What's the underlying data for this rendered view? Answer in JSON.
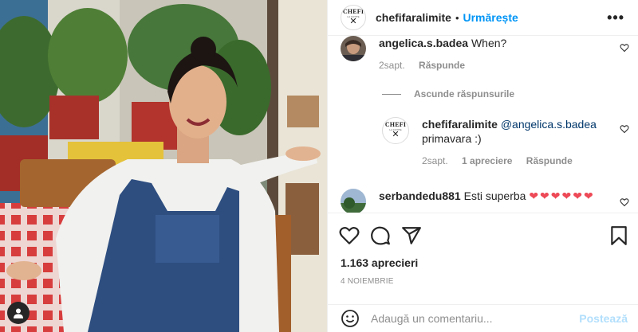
{
  "header": {
    "account": "chefifaralimite",
    "separator": "•",
    "follow_label": "Urmărește",
    "more_label": "•••",
    "logo_text": "CHEFI",
    "logo_sub": "LA CUȚITE",
    "logo_symbol": "✕"
  },
  "comments": [
    {
      "user": "angelica.s.badea",
      "text": "When?",
      "age": "2sapt.",
      "reply_label": "Răspunde"
    }
  ],
  "hide_replies_label": "Ascunde răspunsurile",
  "reply": {
    "user": "chefifaralimite",
    "mention": "@angelica.s.badea",
    "text": "primavara :)",
    "age": "2sapt.",
    "likes": "1 apreciere",
    "reply_label": "Răspunde"
  },
  "comment3": {
    "user": "serbandedu881",
    "text": "Esti superba",
    "hearts": "❤❤❤❤❤❤"
  },
  "likes_count": "1.163 aprecieri",
  "date": "4 NOIEMBRIE",
  "add_comment": {
    "placeholder": "Adaugă un comentariu...",
    "post_label": "Postează"
  },
  "colors": {
    "accent": "#0095f6",
    "heart_red": "#ed4956",
    "muted": "#8e8e8e"
  },
  "icons": [
    "user-tag-icon",
    "heart-icon",
    "comment-icon",
    "share-icon",
    "bookmark-icon",
    "emoji-icon",
    "more-options-icon"
  ]
}
